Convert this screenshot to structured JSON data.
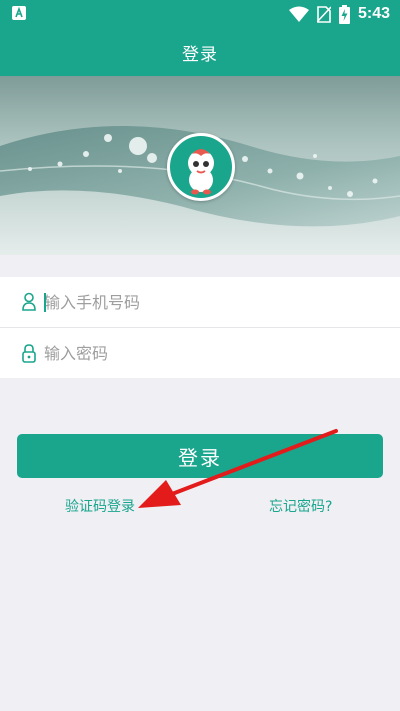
{
  "status_bar": {
    "time": "5:43",
    "icons": [
      "notification-a-icon",
      "wifi-icon",
      "no-sim-icon",
      "battery-charging-icon"
    ]
  },
  "app_bar": {
    "title": "登录"
  },
  "form": {
    "phone_placeholder": "输入手机号码",
    "password_placeholder": "输入密码"
  },
  "actions": {
    "login_label": "登录",
    "code_login_label": "验证码登录",
    "forgot_password_label": "忘记密码?"
  },
  "colors": {
    "accent": "#1aa58d",
    "annotation_arrow": "#e31b1b"
  }
}
